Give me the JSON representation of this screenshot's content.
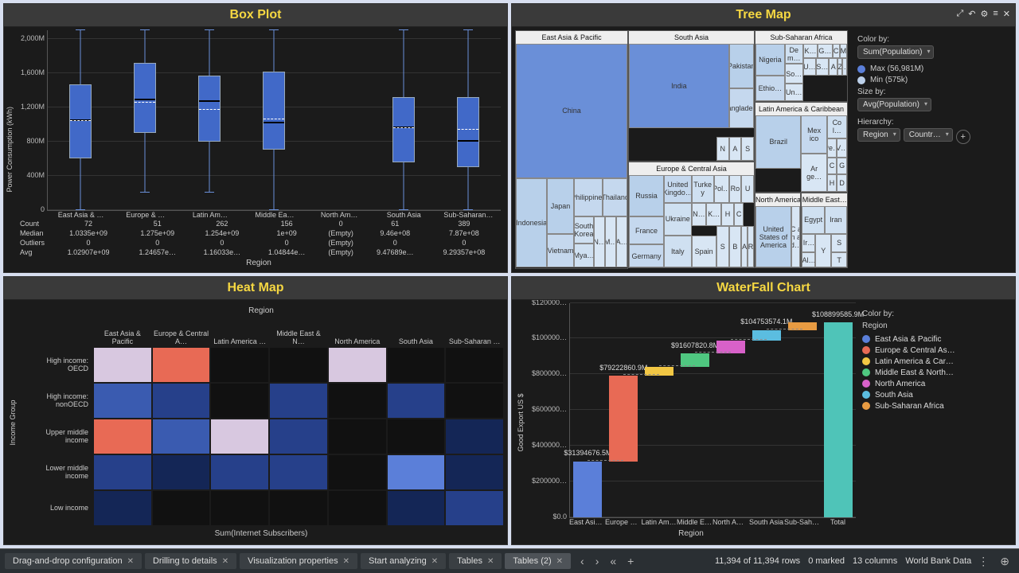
{
  "titles": {
    "boxplot": "Box Plot",
    "treemap": "Tree Map",
    "heatmap": "Heat Map",
    "waterfall": "WaterFall Chart"
  },
  "boxplot_ylabel": "Power Consumption (kWh)",
  "boxplot_xlabel": "Region",
  "boxplot_regions": [
    "East Asia & …",
    "Europe & …",
    "Latin Am…",
    "Middle Ea…",
    "North Am…",
    "South Asia",
    "Sub-Saharan…"
  ],
  "boxplot_stats": {
    "rows": [
      "Count",
      "Median",
      "Outliers",
      "Avg"
    ],
    "values": [
      [
        "72",
        "51",
        "262",
        "156",
        "0",
        "61",
        "389"
      ],
      [
        "1.0335e+09",
        "1.275e+09",
        "1.254e+09",
        "1e+09",
        "(Empty)",
        "9.46e+08",
        "7.87e+08"
      ],
      [
        "0",
        "0",
        "0",
        "0",
        "(Empty)",
        "0",
        "0"
      ],
      [
        "1.02907e+09",
        "1.24657e…",
        "1.16033e…",
        "1.04844e…",
        "(Empty)",
        "9.47689e…",
        "9.29357e+08"
      ]
    ]
  },
  "treemap_side": {
    "color_by": "Color by:",
    "color_sel": "Sum(Population)",
    "max": "Max (56,981M)",
    "min": "Min (575k)",
    "size_by": "Size by:",
    "size_sel": "Avg(Population)",
    "hierarchy": "Hierarchy:",
    "h1": "Region",
    "h2": "Countr…"
  },
  "treemap_regions": [
    "East Asia & Pacific",
    "South Asia",
    "Sub-Saharan Africa",
    "Europe & Central Asia",
    "Latin America & Caribbean",
    "North America",
    "Middle East…"
  ],
  "tm_cells": {
    "china": "China",
    "indonesia": "Indonesia",
    "japan": "Japan",
    "philippines": "Philippines",
    "thailand": "Thailand",
    "vietnam": "Vietnam",
    "skorea": "South Korea",
    "mya": "Mya…",
    "n": "N…",
    "m": "M…",
    "a": "A…",
    "india": "India",
    "pakistan": "Pakistan",
    "bangladesh": "Bangladesh",
    "na": "N",
    "aa": "A",
    "s": "S",
    "nigeria": "Nigeria",
    "ethiopia": "Ethio…",
    "dem": "De m…",
    "k": "K…",
    "so": "So…",
    "un": "Un…",
    "g": "G…",
    "c": "C",
    "mz": "M",
    "u": "U…",
    "si": "S…",
    "a2": "A",
    "z": "Z",
    "b": "B…",
    "russia": "Russia",
    "france": "France",
    "germany": "Germany",
    "uk": "United Kingdo…",
    "ukraine": "Ukraine",
    "italy": "Italy",
    "spain": "Spain",
    "turkey": "Turke y",
    "poland": "Pol…",
    "ro": "Ro",
    "u2": "U",
    "n2": "N…",
    "k2": "K…",
    "h": "H",
    "c2": "C",
    "s2": "S",
    "b2": "B",
    "a3": "A",
    "r": "R",
    "brazil": "Brazil",
    "mexico": "Mex ico",
    "col": "Co l…",
    "arg": "Ar ge…",
    "pe": "Pe…",
    "v": "V…",
    "c3": "C",
    "g2": "G",
    "h2": "H",
    "d": "D",
    "usa": "United States of America",
    "canada": "C a n a d…",
    "egypt": "Egypt",
    "iran": "Iran",
    "ir": "Ir…",
    "al": "Al…",
    "y": "Y",
    "s3": "S",
    "t": "T"
  },
  "heatmap_xlabel": "Region",
  "heatmap_ylabel": "Income Group",
  "heatmap_blabel": "Sum(Internet Subscribers)",
  "heatmap_cols": [
    "East Asia & Pacific",
    "Europe & Central A…",
    "Latin America …",
    "Middle East & N…",
    "North America",
    "South Asia",
    "Sub-Saharan …"
  ],
  "heatmap_rows": [
    "High income: OECD",
    "High income: nonOECD",
    "Upper middle income",
    "Lower middle income",
    "Low income"
  ],
  "waterfall_ylabel": "Good Export US $",
  "waterfall_xlabel": "Region",
  "waterfall_legend_title": "Color by:",
  "waterfall_legend_sub": "Region",
  "waterfall_legend": [
    "East Asia & Pacific",
    "Europe & Central As…",
    "Latin America & Car…",
    "Middle East & North…",
    "North America",
    "South Asia",
    "Sub-Saharan Africa"
  ],
  "bottom": {
    "tabs": [
      "Drag-and-drop configuration",
      "Drilling to details",
      "Visualization properties",
      "Start analyzing",
      "Tables",
      "Tables (2)"
    ],
    "rows": "11,394 of 11,394 rows",
    "marked": "0 marked",
    "cols": "13 columns",
    "src": "World Bank Data"
  },
  "chart_data": [
    {
      "type": "boxplot",
      "title": "Box Plot",
      "ylabel": "Power Consumption (kWh)",
      "xlabel": "Region",
      "ylim": [
        0,
        2100000000
      ],
      "categories": [
        "East Asia & Pacific",
        "Europe & Central Asia",
        "Latin America",
        "Middle East",
        "North America",
        "South Asia",
        "Sub-Saharan"
      ],
      "boxes": [
        {
          "min": 0,
          "q1": 600000000,
          "median": 1033500000,
          "q3": 1450000000,
          "max": 2100000000,
          "mean": 1029070000,
          "count": 72
        },
        {
          "min": 200000000,
          "q1": 900000000,
          "median": 1275000000,
          "q3": 1700000000,
          "max": 2100000000,
          "mean": 1246570000,
          "count": 51
        },
        {
          "min": 200000000,
          "q1": 800000000,
          "median": 1254000000,
          "q3": 1550000000,
          "max": 2100000000,
          "mean": 1160330000,
          "count": 262
        },
        {
          "min": 0,
          "q1": 700000000,
          "median": 1000000000,
          "q3": 1600000000,
          "max": 2100000000,
          "mean": 1048440000,
          "count": 156
        },
        {
          "min": null,
          "q1": null,
          "median": null,
          "q3": null,
          "max": null,
          "mean": null,
          "count": 0
        },
        {
          "min": 0,
          "q1": 550000000,
          "median": 946000000,
          "q3": 1300000000,
          "max": 2100000000,
          "mean": 947689000,
          "count": 61
        },
        {
          "min": 0,
          "q1": 500000000,
          "median": 787000000,
          "q3": 1300000000,
          "max": 2100000000,
          "mean": 929357000,
          "count": 389
        }
      ]
    },
    {
      "type": "treemap",
      "title": "Tree Map",
      "size_by": "Avg(Population)",
      "color_by": "Sum(Population)",
      "color_range": [
        575000,
        56981000000
      ],
      "hierarchy": [
        "Region",
        "Country"
      ],
      "regions": {
        "East Asia & Pacific": [
          "China",
          "Indonesia",
          "Japan",
          "Philippines",
          "Vietnam",
          "Thailand",
          "South Korea",
          "Myanmar"
        ],
        "South Asia": [
          "India",
          "Pakistan",
          "Bangladesh",
          "Nepal",
          "Afghanistan",
          "Sri Lanka"
        ],
        "Sub-Saharan Africa": [
          "Nigeria",
          "Ethiopia",
          "Dem. Rep. Congo",
          "Kenya",
          "South Africa",
          "Uganda"
        ],
        "Europe & Central Asia": [
          "Russia",
          "France",
          "Germany",
          "United Kingdom",
          "Ukraine",
          "Italy",
          "Spain",
          "Turkey",
          "Poland",
          "Romania"
        ],
        "Latin America & Caribbean": [
          "Brazil",
          "Mexico",
          "Colombia",
          "Argentina",
          "Peru",
          "Venezuela"
        ],
        "North America": [
          "United States of America",
          "Canada"
        ],
        "Middle East & North Africa": [
          "Egypt",
          "Iran",
          "Iraq",
          "Algeria"
        ]
      }
    },
    {
      "type": "heatmap",
      "title": "Heat Map",
      "xlabel": "Region",
      "ylabel": "Income Group",
      "value": "Sum(Internet Subscribers)",
      "x": [
        "East Asia & Pacific",
        "Europe & Central Asia",
        "Latin America",
        "Middle East & N Africa",
        "North America",
        "South Asia",
        "Sub-Saharan"
      ],
      "y": [
        "High income: OECD",
        "High income: nonOECD",
        "Upper middle income",
        "Lower middle income",
        "Low income"
      ],
      "z_rel": [
        [
          0.85,
          0.98,
          null,
          null,
          0.9,
          null,
          null
        ],
        [
          0.35,
          0.25,
          null,
          0.3,
          null,
          0.3,
          null
        ],
        [
          0.95,
          0.4,
          0.7,
          0.3,
          null,
          null,
          0.1
        ],
        [
          0.3,
          0.15,
          0.25,
          0.2,
          null,
          0.5,
          0.15
        ],
        [
          0.05,
          null,
          null,
          null,
          null,
          0.1,
          0.25
        ]
      ]
    },
    {
      "type": "waterfall",
      "title": "WaterFall Chart",
      "ylabel": "Good Export US $",
      "xlabel": "Region",
      "ylim": [
        0,
        120000000
      ],
      "categories": [
        "East Asia & Pacific",
        "Europe & Central Asia",
        "Latin America & Caribbean",
        "Middle East & North Africa",
        "North America",
        "South Asia",
        "Sub-Saharan Africa",
        "Total"
      ],
      "cumulative": [
        31394676.5,
        79222860.9,
        84000000,
        91607820.8,
        99000000,
        104753574.1,
        108899585.9,
        108899585.9
      ],
      "labels": [
        "$31394676.5M",
        "$79222860.9M",
        "",
        "$91607820.8M",
        "",
        "$104753574.1M",
        "",
        "$108899585.9M"
      ],
      "colors": [
        "#5b7fd9",
        "#e86a55",
        "#f2c744",
        "#4fc780",
        "#d861c9",
        "#5bbde0",
        "#e89b42",
        "#4fc4b8"
      ]
    }
  ]
}
